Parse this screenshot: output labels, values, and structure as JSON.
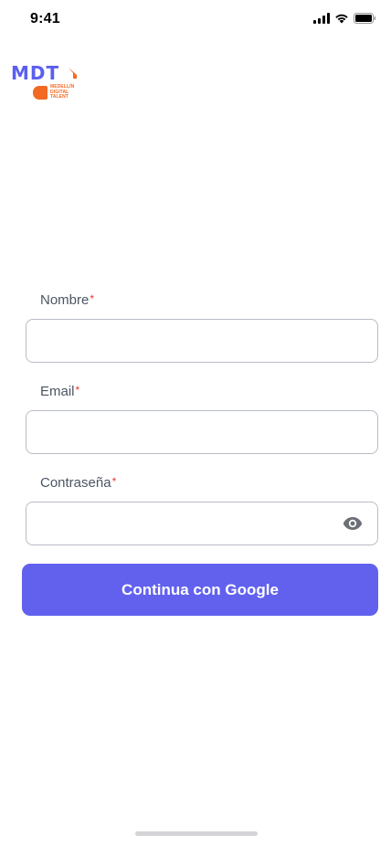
{
  "status_bar": {
    "time": "9:41",
    "icons": [
      "cellular-signal-icon",
      "wifi-icon",
      "battery-icon"
    ]
  },
  "logo": {
    "text": "MDT",
    "subtitle": "MEDELLÍN\nDIGITAL\nTALENT",
    "colors": {
      "primary": "#5b5ff0",
      "accent": "#f26a21"
    }
  },
  "form": {
    "name": {
      "label": "Nombre",
      "required_mark": "*",
      "value": ""
    },
    "email": {
      "label": "Email",
      "required_mark": "*",
      "value": ""
    },
    "password": {
      "label": "Contraseña",
      "required_mark": "*",
      "value": "",
      "toggle_icon": "eye-icon"
    }
  },
  "actions": {
    "google_button": {
      "label": "Continua con Google",
      "color": "#6161ee"
    }
  }
}
